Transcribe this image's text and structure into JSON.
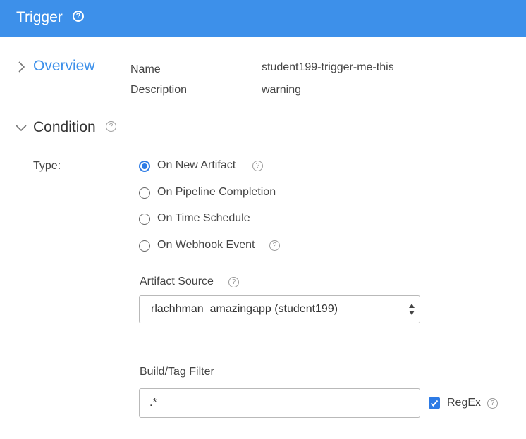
{
  "header": {
    "title": "Trigger",
    "help_symbol": "?"
  },
  "overview": {
    "title": "Overview",
    "fields": [
      {
        "label": "Name",
        "value": "student199-trigger-me-this"
      },
      {
        "label": "Description",
        "value": "warning"
      }
    ]
  },
  "condition": {
    "title": "Condition",
    "help_symbol": "?",
    "type_label": "Type:",
    "options": [
      {
        "label": "On New Artifact",
        "checked": true,
        "has_help": true
      },
      {
        "label": "On Pipeline Completion",
        "checked": false,
        "has_help": false
      },
      {
        "label": "On Time Schedule",
        "checked": false,
        "has_help": false
      },
      {
        "label": "On Webhook Event",
        "checked": false,
        "has_help": true
      }
    ],
    "artifact_source": {
      "label": "Artifact Source",
      "selected": "rlachhman_amazingapp (student199)"
    },
    "build_tag_filter": {
      "label": "Build/Tag Filter",
      "value": ".*",
      "regex_label": "RegEx",
      "regex_checked": true
    }
  },
  "colors": {
    "header_bg": "#3d90ea",
    "accent": "#2d7be5"
  }
}
